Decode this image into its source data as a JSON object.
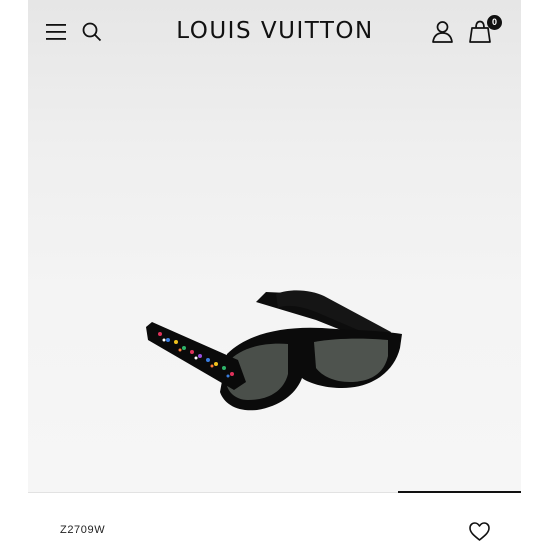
{
  "header": {
    "brand": "LOUIS VUITTON",
    "cart_count": "0",
    "icons": {
      "menu": "menu-icon",
      "search": "search-icon",
      "account": "account-icon",
      "bag": "shopping-bag-icon"
    }
  },
  "product": {
    "sku": "Z2709W",
    "image_alt": "Black rectangular sunglasses with multicolor monogram temples",
    "wishlist_icon": "heart-icon"
  },
  "carousel": {
    "progress": 0.25
  },
  "colors": {
    "text": "#111111",
    "hero_top": "#e6e6e6",
    "hero_bottom": "#f6f6f6"
  }
}
